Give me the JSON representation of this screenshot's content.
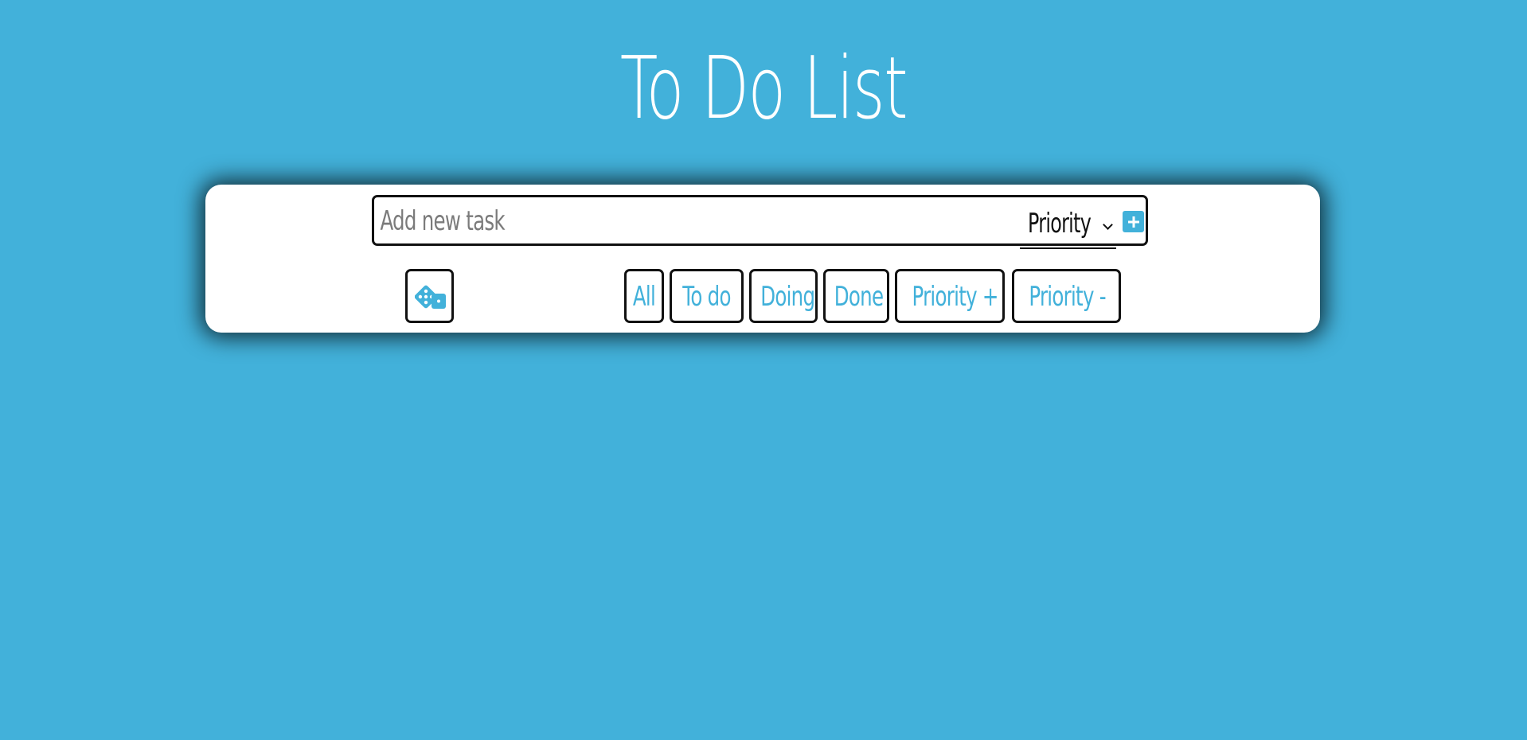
{
  "page": {
    "title": "To Do List"
  },
  "new_task": {
    "placeholder": "Add new task",
    "value": "",
    "priority_label": "Priority",
    "add_icon": "plus-icon"
  },
  "toolbar": {
    "random_icon": "dice-icon",
    "filters": [
      "All",
      "To do",
      "Doing",
      "Done",
      "Priority +",
      "Priority -"
    ]
  },
  "colors": {
    "background": "#42b1da",
    "card": "#ffffff",
    "accent": "#42b1da",
    "border": "#111111"
  }
}
